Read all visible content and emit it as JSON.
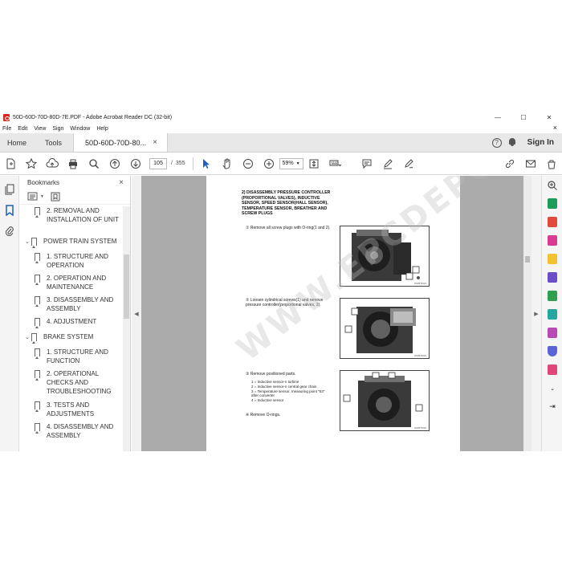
{
  "window": {
    "title": "50D-60D-70D-80D-7E.PDF - Adobe Acrobat Reader DC (32-bit)",
    "minimize": "—",
    "maximize": "☐",
    "close": "✕"
  },
  "menu": [
    "File",
    "Edit",
    "View",
    "Sign",
    "Window",
    "Help"
  ],
  "menu_close": "×",
  "tabs": {
    "home": "Home",
    "tools": "Tools",
    "document": "50D-60D-70D-80...",
    "doc_close": "×"
  },
  "signin": "Sign In",
  "help_glyph": "?",
  "toolbar": {
    "page_current": "105",
    "page_sep": "/",
    "page_total": "355",
    "zoom": "59%"
  },
  "bookmarks": {
    "header": "Bookmarks",
    "close": "×",
    "items": [
      {
        "label": "2. REMOVAL AND INSTALLATION OF UNIT",
        "level": 2
      },
      {
        "label": "POWER TRAIN SYSTEM",
        "level": 1
      },
      {
        "label": "1. STRUCTURE AND OPERATION",
        "level": 2
      },
      {
        "label": "2. OPERATION AND MAINTENANCE",
        "level": 2
      },
      {
        "label": "3. DISASSEMBLY AND ASSEMBLY",
        "level": 2
      },
      {
        "label": "4. ADJUSTMENT",
        "level": 2
      },
      {
        "label": "BRAKE SYSTEM",
        "level": 1
      },
      {
        "label": "1. STRUCTURE AND FUNCTION",
        "level": 2
      },
      {
        "label": "2. OPERATIONAL CHECKS AND TROUBLESHOOTING",
        "level": 2
      },
      {
        "label": "3. TESTS AND ADJUSTMENTS",
        "level": 2
      },
      {
        "label": "4. DISASSEMBLY AND ASSEMBLY",
        "level": 2
      }
    ]
  },
  "page": {
    "heading": "2) DISASSEMBLY PRESSURE CONTROLLER (PROPORTIONAL VALVES), INDUCTIVE SENSOR, SPEED SENSOR(HALL SENSOR), TEMPERATURE SENSOR, BREATHER AND SCREW PLUGS",
    "step1": "① Remove all screw plugs with O-ring(1 and 2).",
    "step2": "② Loosen cylindrical screws(1) and remove pressure controller(proportional valves, 2).",
    "step3": "③ Remove positioned parts.",
    "legend": [
      "1 = Inductive sensor-n turbine",
      "2 = Inductive sensor-n central gear chain",
      "3 = Temperature sensor, measuring point \"63\" after converter",
      "4 = Inductive sensor"
    ],
    "note": "※ Remove O-rings.",
    "captions": [
      "D505TM14",
      "D505TM15",
      "D505TM16"
    ],
    "watermark": "WWW.EPCDEPOT.COM"
  },
  "colors": {
    "acrobat_red": "#d8261c",
    "doc_background": "#ababab",
    "tab_bar": "#e8e8e8"
  }
}
